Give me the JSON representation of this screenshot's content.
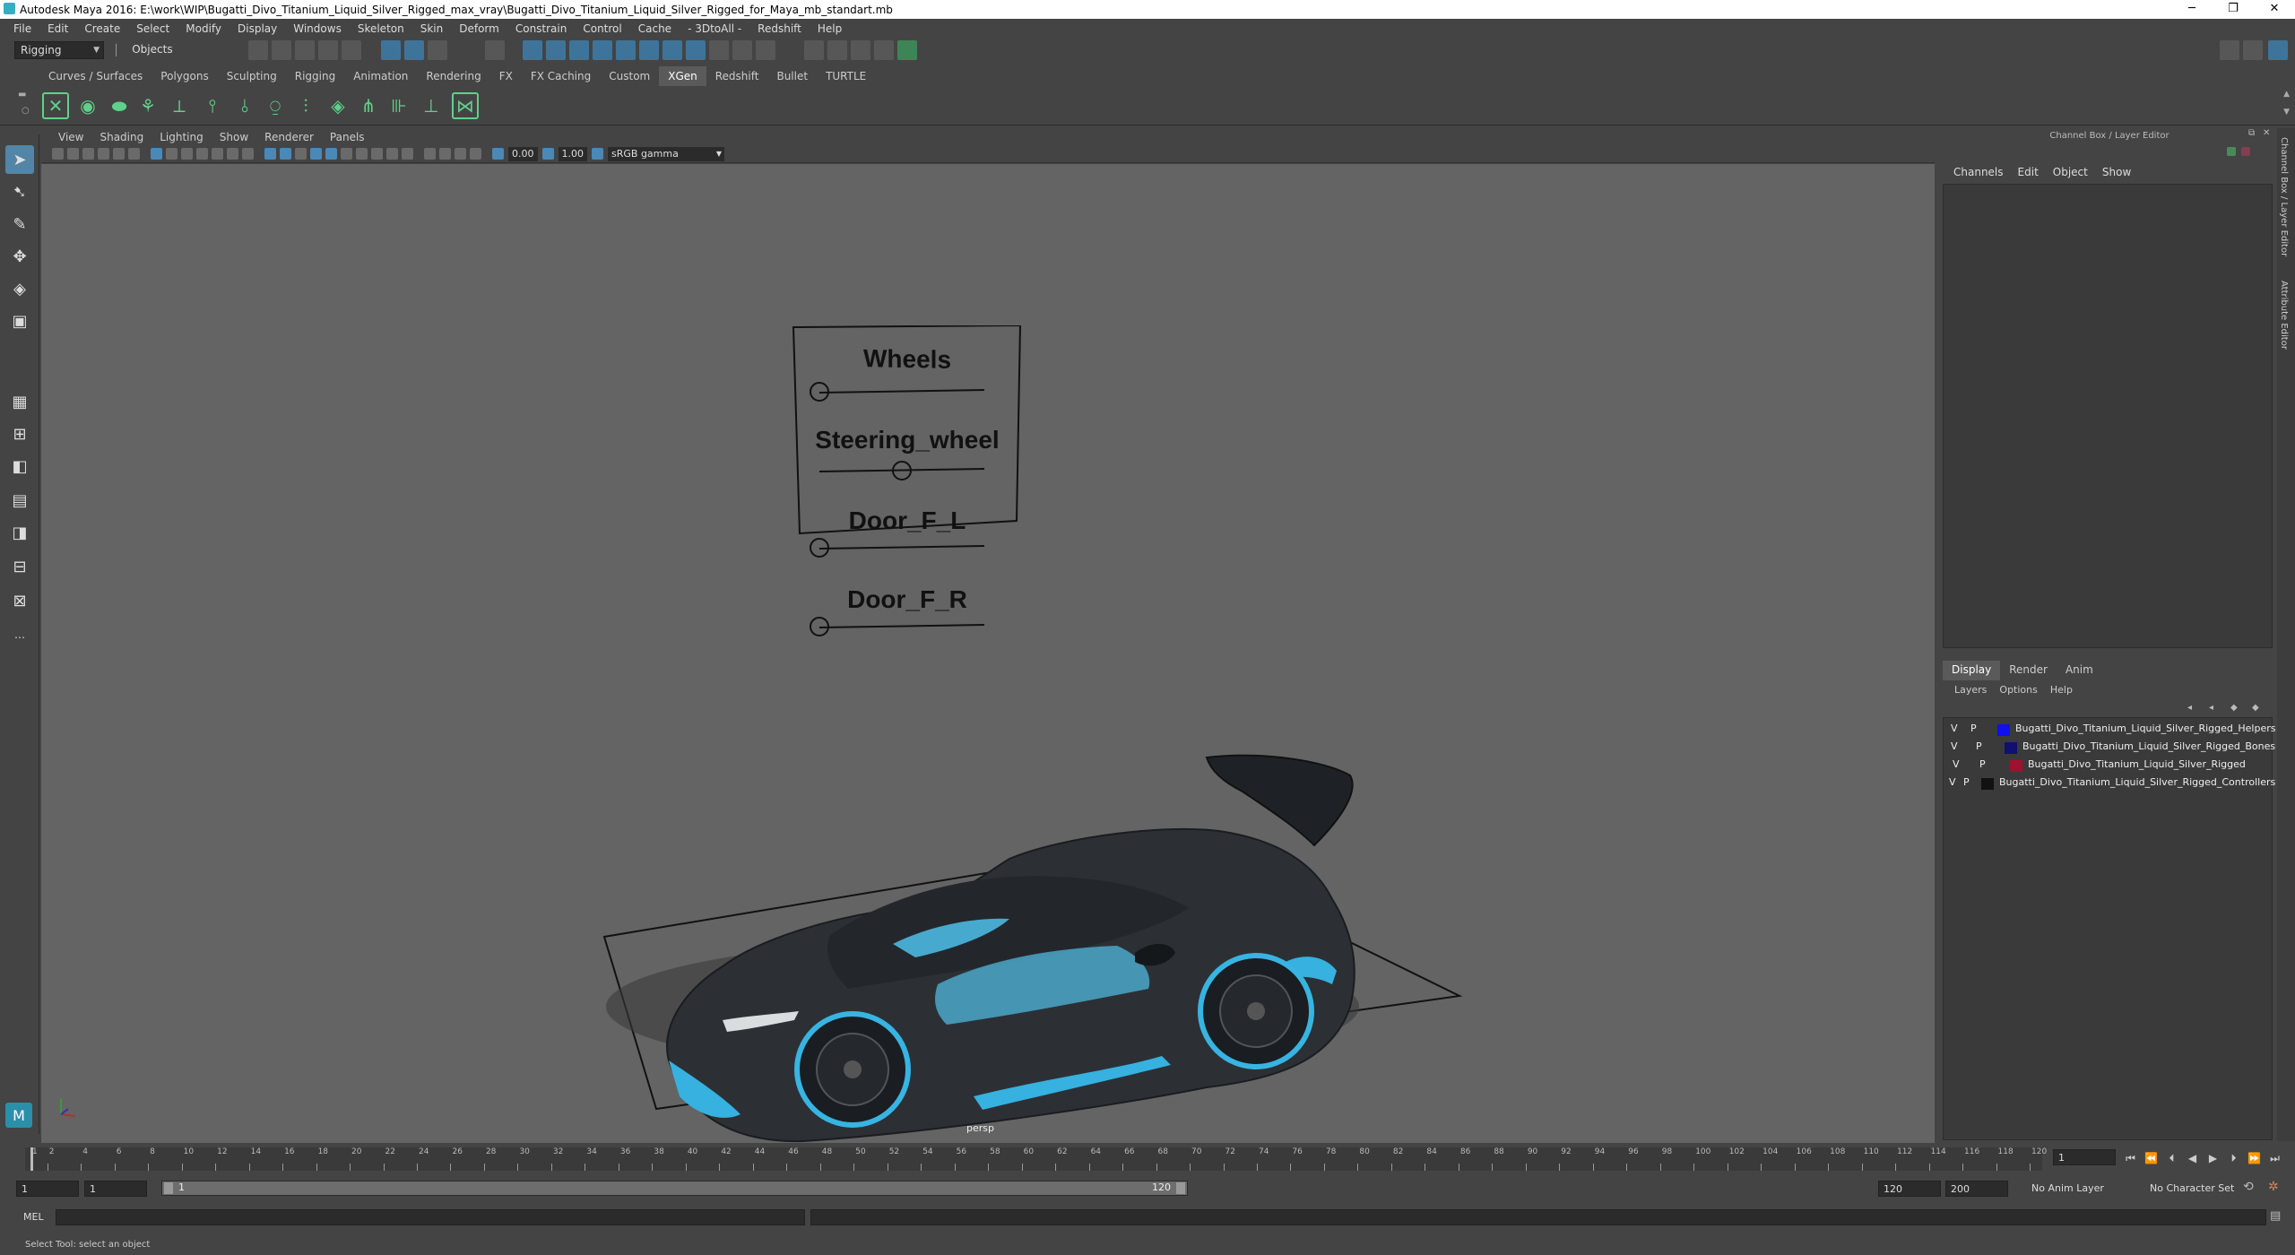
{
  "window": {
    "title": "Autodesk Maya 2016: E:\\work\\WIP\\Bugatti_Divo_Titanium_Liquid_Silver_Rigged_max_vray\\Bugatti_Divo_Titanium_Liquid_Silver_Rigged_for_Maya_mb_standart.mb",
    "minimize": "─",
    "restore": "❐",
    "close": "✕"
  },
  "menubar": [
    "File",
    "Edit",
    "Create",
    "Select",
    "Modify",
    "Display",
    "Windows",
    "Skeleton",
    "Skin",
    "Deform",
    "Constrain",
    "Control",
    "Cache",
    "- 3DtoAll -",
    "Redshift",
    "Help"
  ],
  "statusline": {
    "mode": "Rigging",
    "selection_mode": "Objects"
  },
  "shelf_tabs": {
    "items": [
      "Curves / Surfaces",
      "Polygons",
      "Sculpting",
      "Rigging",
      "Animation",
      "Rendering",
      "FX",
      "FX Caching",
      "Custom",
      "XGen",
      "Redshift",
      "Bullet",
      "TURTLE"
    ],
    "active": "XGen"
  },
  "viewport": {
    "menu": [
      "View",
      "Shading",
      "Lighting",
      "Show",
      "Renderer",
      "Panels"
    ],
    "exposure": "0.00",
    "gamma": "1.00",
    "color_space": "sRGB gamma",
    "camera_label": "persp",
    "controller_board": {
      "sliders": [
        {
          "label": "Wheels",
          "value": 0
        },
        {
          "label": "Steering_wheel",
          "value": 0.5
        },
        {
          "label": "Door_F_L",
          "value": 0
        },
        {
          "label": "Door_F_R",
          "value": 0
        }
      ]
    }
  },
  "channel_box": {
    "header": "Channel Box / Layer Editor",
    "menu": [
      "Channels",
      "Edit",
      "Object",
      "Show"
    ]
  },
  "side_tabs": [
    "Channel Box / Layer Editor",
    "Attribute Editor"
  ],
  "layer_editor": {
    "tabs": [
      "Display",
      "Render",
      "Anim"
    ],
    "active_tab": "Display",
    "menu": [
      "Layers",
      "Options",
      "Help"
    ],
    "layers": [
      {
        "v": "V",
        "p": "P",
        "color": "#1010ee",
        "name": "Bugatti_Divo_Titanium_Liquid_Silver_Rigged_Helpers"
      },
      {
        "v": "V",
        "p": "P",
        "color": "#101070",
        "name": "Bugatti_Divo_Titanium_Liquid_Silver_Rigged_Bones"
      },
      {
        "v": "V",
        "p": "P",
        "color": "#a01030",
        "name": "Bugatti_Divo_Titanium_Liquid_Silver_Rigged"
      },
      {
        "v": "V",
        "p": "P",
        "color": "#111111",
        "name": "Bugatti_Divo_Titanium_Liquid_Silver_Rigged_Controllers"
      }
    ]
  },
  "time_slider": {
    "ticks": [
      "1",
      "2",
      "4",
      "6",
      "8",
      "10",
      "12",
      "14",
      "16",
      "18",
      "20",
      "22",
      "24",
      "26",
      "28",
      "30",
      "32",
      "34",
      "36",
      "38",
      "40",
      "42",
      "44",
      "46",
      "48",
      "50",
      "52",
      "54",
      "56",
      "58",
      "60",
      "62",
      "64",
      "66",
      "68",
      "70",
      "72",
      "74",
      "76",
      "78",
      "80",
      "82",
      "84",
      "86",
      "88",
      "90",
      "92",
      "94",
      "96",
      "98",
      "100",
      "102",
      "104",
      "106",
      "108",
      "110",
      "112",
      "114",
      "116",
      "118",
      "120"
    ],
    "current_frame": "1",
    "current_frame_position": 0
  },
  "range_slider": {
    "start": "1",
    "playback_start": "1",
    "range_start_label": "1",
    "range_end_label": "120",
    "playback_end": "120",
    "end": "200",
    "anim_layer": "No Anim Layer",
    "character_set": "No Character Set"
  },
  "command_line": {
    "lang": "MEL"
  },
  "help_line": "Select Tool: select an object"
}
